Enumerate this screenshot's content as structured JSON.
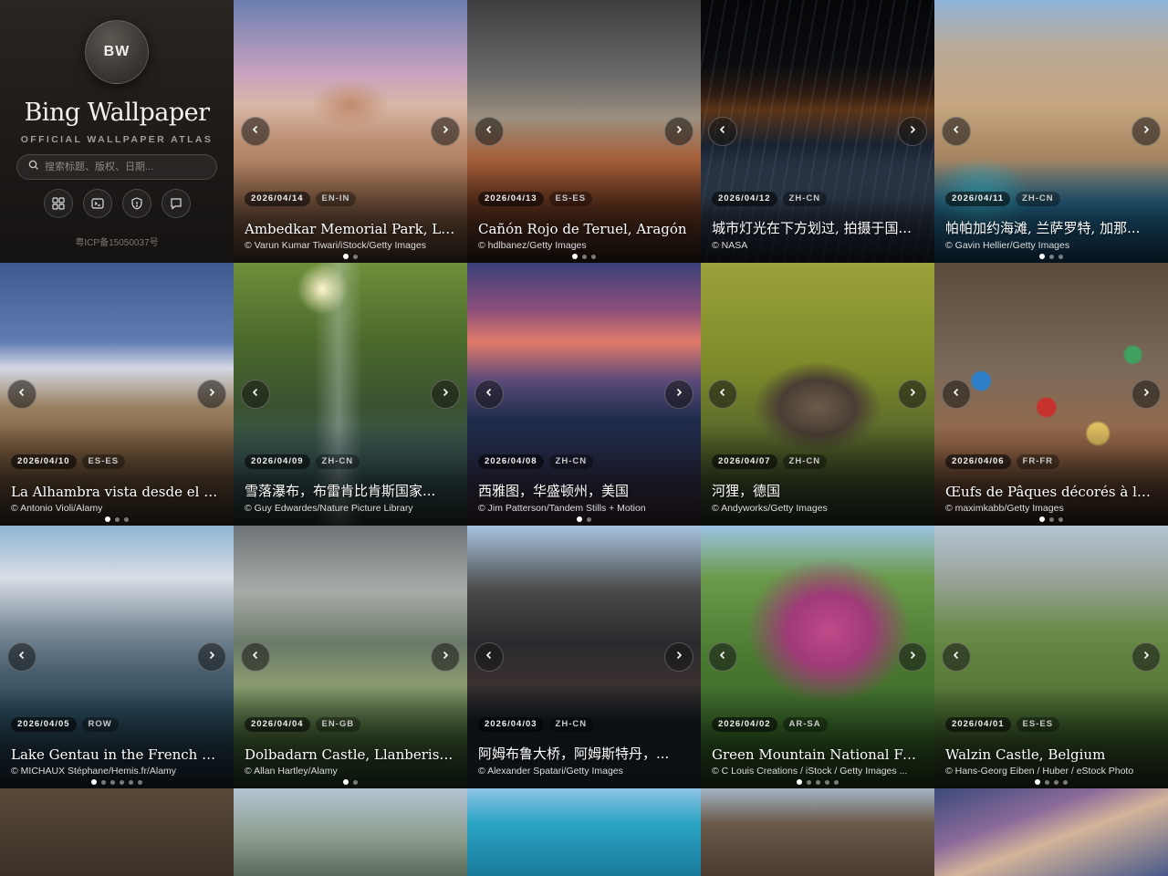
{
  "brand": {
    "logo_text": "BW",
    "title": "Bing Wallpaper",
    "subtitle": "OFFICIAL WALLPAPER ATLAS",
    "search_placeholder": "搜索标题、版权、日期...",
    "icp": "粤ICP备15050037号",
    "icons": [
      "grid-icon",
      "terminal-icon",
      "shield-icon",
      "message-icon"
    ]
  },
  "cards": [
    {
      "date": "2026/04/14",
      "market": "EN-IN",
      "title": "Ambedkar Memorial Park, Luckn...",
      "copyright": "© Varun Kumar Tiwari/iStock/Getty Images",
      "dots": 2,
      "active": 0
    },
    {
      "date": "2026/04/13",
      "market": "ES-ES",
      "title": "Cañón Rojo de Teruel, Aragón",
      "copyright": "© hdlbanez/Getty Images",
      "dots": 3,
      "active": 0
    },
    {
      "date": "2026/04/12",
      "market": "ZH-CN",
      "title": "城市灯光在下方划过, 拍摄于国...",
      "copyright": "© NASA",
      "dots": 0,
      "active": 0
    },
    {
      "date": "2026/04/11",
      "market": "ZH-CN",
      "title": "帕帕加约海滩, 兰萨罗特, 加那...",
      "copyright": "© Gavin Hellier/Getty Images",
      "dots": 3,
      "active": 0
    },
    {
      "date": "2026/04/10",
      "market": "ES-ES",
      "title": "La Alhambra vista desde el Albaici...",
      "copyright": "© Antonio Violi/Alamy",
      "dots": 3,
      "active": 0
    },
    {
      "date": "2026/04/09",
      "market": "ZH-CN",
      "title": "雪落瀑布，布雷肯比肯斯国家...",
      "copyright": "© Guy Edwardes/Nature Picture Library",
      "dots": 0,
      "active": 0
    },
    {
      "date": "2026/04/08",
      "market": "ZH-CN",
      "title": "西雅图，华盛顿州，美国",
      "copyright": "© Jim Patterson/Tandem Stills + Motion",
      "dots": 2,
      "active": 0
    },
    {
      "date": "2026/04/07",
      "market": "ZH-CN",
      "title": "河狸，德国",
      "copyright": "© Andyworks/Getty Images",
      "dots": 0,
      "active": 0
    },
    {
      "date": "2026/04/06",
      "market": "FR-FR",
      "title": "Œufs de Pâques décorés à la main, ...",
      "copyright": "© maximkabb/Getty Images",
      "dots": 3,
      "active": 0
    },
    {
      "date": "2026/04/05",
      "market": "ROW",
      "title": "Lake Gentau in the French Pyrene...",
      "copyright": "© MICHAUX Stéphane/Hemis.fr/Alamy",
      "dots": 6,
      "active": 0
    },
    {
      "date": "2026/04/04",
      "market": "EN-GB",
      "title": "Dolbadarn Castle, Llanberis, Snow...",
      "copyright": "© Allan Hartley/Alamy",
      "dots": 2,
      "active": 0
    },
    {
      "date": "2026/04/03",
      "market": "ZH-CN",
      "title": "阿姆布鲁大桥，阿姆斯特丹，...",
      "copyright": "© Alexander Spatari/Getty Images",
      "dots": 0,
      "active": 0
    },
    {
      "date": "2026/04/02",
      "market": "AR-SA",
      "title": "Green Mountain National Forest, ...",
      "copyright": "© C Louis Creations / iStock / Getty Images ...",
      "dots": 5,
      "active": 0
    },
    {
      "date": "2026/04/01",
      "market": "ES-ES",
      "title": "Walzin Castle, Belgium",
      "copyright": "© Hans-Georg Eiben / Huber / eStock Photo",
      "dots": 4,
      "active": 0
    }
  ],
  "colors": {
    "panel": "#1d1a18",
    "chip_bg": "#000000"
  }
}
